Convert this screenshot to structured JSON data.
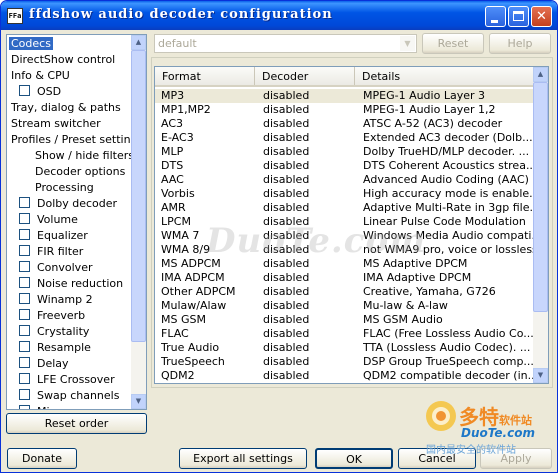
{
  "window": {
    "title": "ffdshow audio decoder configuration",
    "app_icon_text": "FFa"
  },
  "tree": {
    "items": [
      {
        "label": "Codecs",
        "selected": true,
        "checkbox": false,
        "indent": 0
      },
      {
        "label": "DirectShow control",
        "checkbox": false,
        "indent": 0
      },
      {
        "label": "Info & CPU",
        "checkbox": false,
        "indent": 0
      },
      {
        "label": "OSD",
        "checkbox": true,
        "indent": 1
      },
      {
        "label": "Tray, dialog & paths",
        "checkbox": false,
        "indent": 0
      },
      {
        "label": "Stream switcher",
        "checkbox": false,
        "indent": 0
      },
      {
        "label": "Profiles / Preset settings",
        "checkbox": false,
        "indent": 0
      },
      {
        "label": "Show / hide filters",
        "checkbox": false,
        "indent": 2
      },
      {
        "label": "Decoder options",
        "checkbox": false,
        "indent": 2
      },
      {
        "label": "Processing",
        "checkbox": false,
        "indent": 2
      },
      {
        "label": "Dolby decoder",
        "checkbox": true,
        "indent": 1
      },
      {
        "label": "Volume",
        "checkbox": true,
        "indent": 1
      },
      {
        "label": "Equalizer",
        "checkbox": true,
        "indent": 1
      },
      {
        "label": "FIR filter",
        "checkbox": true,
        "indent": 1
      },
      {
        "label": "Convolver",
        "checkbox": true,
        "indent": 1
      },
      {
        "label": "Noise reduction",
        "checkbox": true,
        "indent": 1
      },
      {
        "label": "Winamp 2",
        "checkbox": true,
        "indent": 1
      },
      {
        "label": "Freeverb",
        "checkbox": true,
        "indent": 1
      },
      {
        "label": "Crystality",
        "checkbox": true,
        "indent": 1
      },
      {
        "label": "Resample",
        "checkbox": true,
        "indent": 1
      },
      {
        "label": "Delay",
        "checkbox": true,
        "indent": 1
      },
      {
        "label": "LFE Crossover",
        "checkbox": true,
        "indent": 1
      },
      {
        "label": "Swap channels",
        "checkbox": true,
        "indent": 1
      },
      {
        "label": "Mixer",
        "checkbox": true,
        "indent": 1
      }
    ]
  },
  "preset": {
    "value": "default",
    "reset_label": "Reset",
    "help_label": "Help"
  },
  "codecs": {
    "columns": [
      "Format",
      "Decoder",
      "Details"
    ],
    "rows": [
      {
        "format": "MP3",
        "decoder": "disabled",
        "details": "MPEG-1 Audio Layer 3"
      },
      {
        "format": "MP1,MP2",
        "decoder": "disabled",
        "details": "MPEG-1 Audio Layer 1,2"
      },
      {
        "format": "AC3",
        "decoder": "disabled",
        "details": "ATSC A-52 (AC3) decoder"
      },
      {
        "format": "E-AC3",
        "decoder": "disabled",
        "details": "Extended AC3 decoder (Dolb..."
      },
      {
        "format": "MLP",
        "decoder": "disabled",
        "details": "Dolby TrueHD/MLP decoder. ..."
      },
      {
        "format": "DTS",
        "decoder": "disabled",
        "details": "DTS Coherent Acoustics strea..."
      },
      {
        "format": "AAC",
        "decoder": "disabled",
        "details": "Advanced Audio Coding (AAC)"
      },
      {
        "format": "Vorbis",
        "decoder": "disabled",
        "details": "High accuracy mode is enable..."
      },
      {
        "format": "AMR",
        "decoder": "disabled",
        "details": "Adaptive Multi-Rate in 3gp file..."
      },
      {
        "format": "LPCM",
        "decoder": "disabled",
        "details": "Linear Pulse Code Modulation"
      },
      {
        "format": "WMA 7",
        "decoder": "disabled",
        "details": "Windows Media Audio compati..."
      },
      {
        "format": "WMA 8/9",
        "decoder": "disabled",
        "details": "not WMA9 pro, voice or lossless"
      },
      {
        "format": "MS ADPCM",
        "decoder": "disabled",
        "details": "MS Adaptive DPCM"
      },
      {
        "format": "IMA ADPCM",
        "decoder": "disabled",
        "details": "IMA Adaptive DPCM"
      },
      {
        "format": "Other ADPCM",
        "decoder": "disabled",
        "details": "Creative, Yamaha, G726"
      },
      {
        "format": "Mulaw/Alaw",
        "decoder": "disabled",
        "details": "Mu-law & A-law"
      },
      {
        "format": "MS GSM",
        "decoder": "disabled",
        "details": "MS GSM Audio"
      },
      {
        "format": "FLAC",
        "decoder": "disabled",
        "details": "FLAC (Free Lossless Audio Co..."
      },
      {
        "format": "True Audio",
        "decoder": "disabled",
        "details": "TTA (Lossless Audio Codec). ..."
      },
      {
        "format": "TrueSpeech",
        "decoder": "disabled",
        "details": "DSP Group TrueSpeech comp..."
      },
      {
        "format": "QDM2",
        "decoder": "disabled",
        "details": "QDM2 compatible decoder (in..."
      }
    ]
  },
  "buttons": {
    "reset_order": "Reset order",
    "donate": "Donate",
    "export_all": "Export all settings",
    "ok": "OK",
    "cancel": "Cancel",
    "apply": "Apply"
  },
  "watermark": {
    "text": "DuoTe.com",
    "logo_zh": "多特",
    "logo_zh_small": "软件站",
    "logo_en": "DuoTe.com",
    "slogan": "国内最安全的软件站"
  }
}
